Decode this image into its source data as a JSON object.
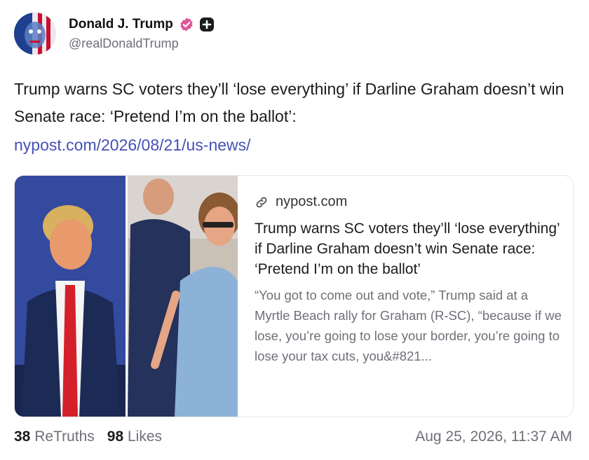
{
  "author": {
    "display_name": "Donald J. Trump",
    "handle": "@realDonaldTrump",
    "avatar_icon": "flag-face-avatar",
    "verified_color": "#e0569b"
  },
  "post": {
    "text": "Trump warns SC voters they’ll ‘lose everything’ if Darline Graham doesn’t win Senate race: ‘Pretend I’m on the ballot’:",
    "link": "nypost.com/2026/08/21/us-news/"
  },
  "card": {
    "domain": "nypost.com",
    "title": "Trump warns SC voters they’ll ‘lose everything’ if Darline Graham doesn’t win Senate race: ‘Pretend I’m on the ballot’",
    "description": "“You got to come out and vote,” Trump said at a Myrtle Beach rally for Graham (R-SC), “because if we lose, you’re going to lose your border, you’re going to lose your tax cuts, you&#821...",
    "image_icon": "news-photo"
  },
  "stats": {
    "retruths_count": "38",
    "retruths_label": "ReTruths",
    "likes_count": "98",
    "likes_label": "Likes"
  },
  "timestamp": "Aug 25, 2026, 11:37 AM",
  "colors": {
    "link": "#4451b5",
    "muted": "#6f6f78",
    "text": "#1c1c1e"
  }
}
